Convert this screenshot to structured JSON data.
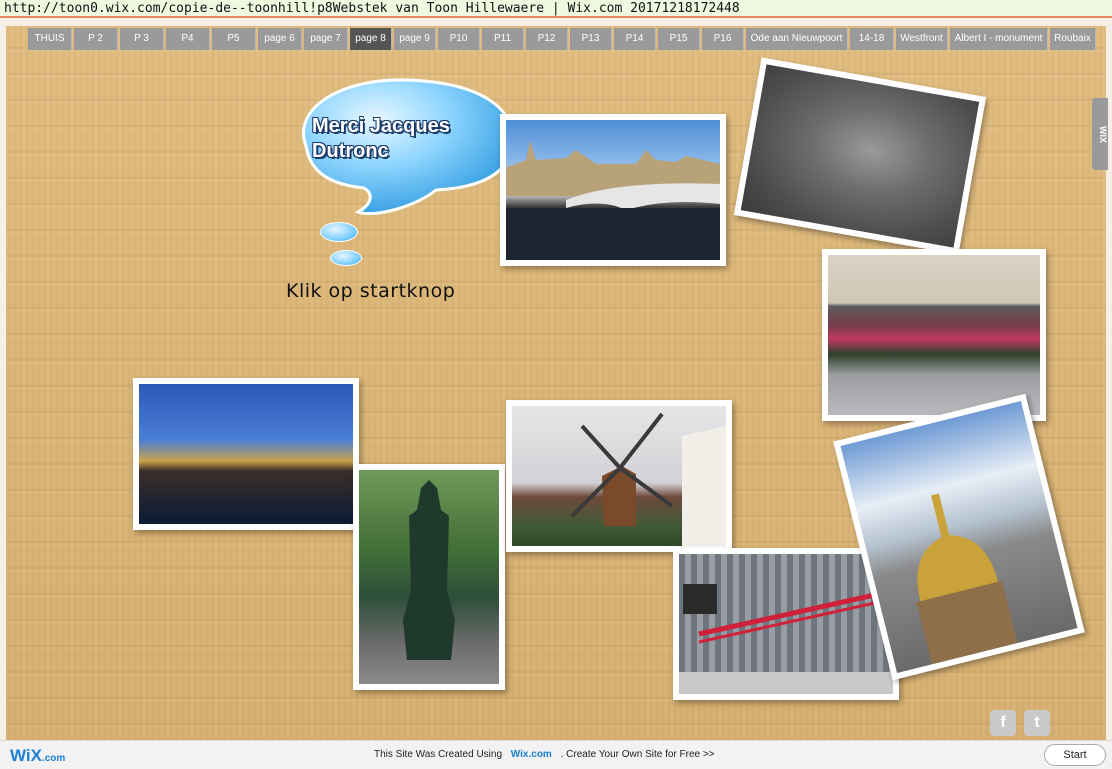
{
  "browser": {
    "url_line": "http://toon0.wix.com/copie-de--toonhill!p8Webstek van Toon Hillewaere | Wix.com 20171218172448"
  },
  "nav": {
    "items": [
      {
        "label": "THUIS",
        "active": false
      },
      {
        "label": "P 2",
        "active": false
      },
      {
        "label": "P 3",
        "active": false
      },
      {
        "label": "P4",
        "active": false
      },
      {
        "label": "P5",
        "active": false
      },
      {
        "label": "page 6",
        "active": false
      },
      {
        "label": "page 7",
        "active": false
      },
      {
        "label": "page 8",
        "active": true
      },
      {
        "label": "page 9",
        "active": false
      },
      {
        "label": "P10",
        "active": false
      },
      {
        "label": "P11",
        "active": false
      },
      {
        "label": "P12",
        "active": false
      },
      {
        "label": "P13",
        "active": false
      },
      {
        "label": "P14",
        "active": false
      },
      {
        "label": "P15",
        "active": false
      },
      {
        "label": "P16",
        "active": false
      },
      {
        "label": "Ode aan Nieuwpoort",
        "active": false
      },
      {
        "label": "14-18",
        "active": false
      },
      {
        "label": "Westfront",
        "active": false
      },
      {
        "label": "Albert I - monument",
        "active": false
      },
      {
        "label": "Roubaix",
        "active": false
      }
    ]
  },
  "bubble": {
    "line1": "Merci Jacques",
    "line2": "Dutronc"
  },
  "start_instruction": "Klik op startknop",
  "side_tab": "WIX",
  "social": {
    "facebook_glyph": "f",
    "twitter_glyph": "t"
  },
  "footer": {
    "logo": "WiX",
    "logo_suffix": ".com",
    "message_before": "This Site Was Created Using",
    "link": "Wix.com",
    "message_after": ". Create Your Own Site for Free >>",
    "start_button": "Start"
  },
  "colors": {
    "nav_bg": "#9a9a9a",
    "nav_active_bg": "#555555",
    "wix_blue": "#1e7fd4",
    "board": "#ddb676"
  }
}
